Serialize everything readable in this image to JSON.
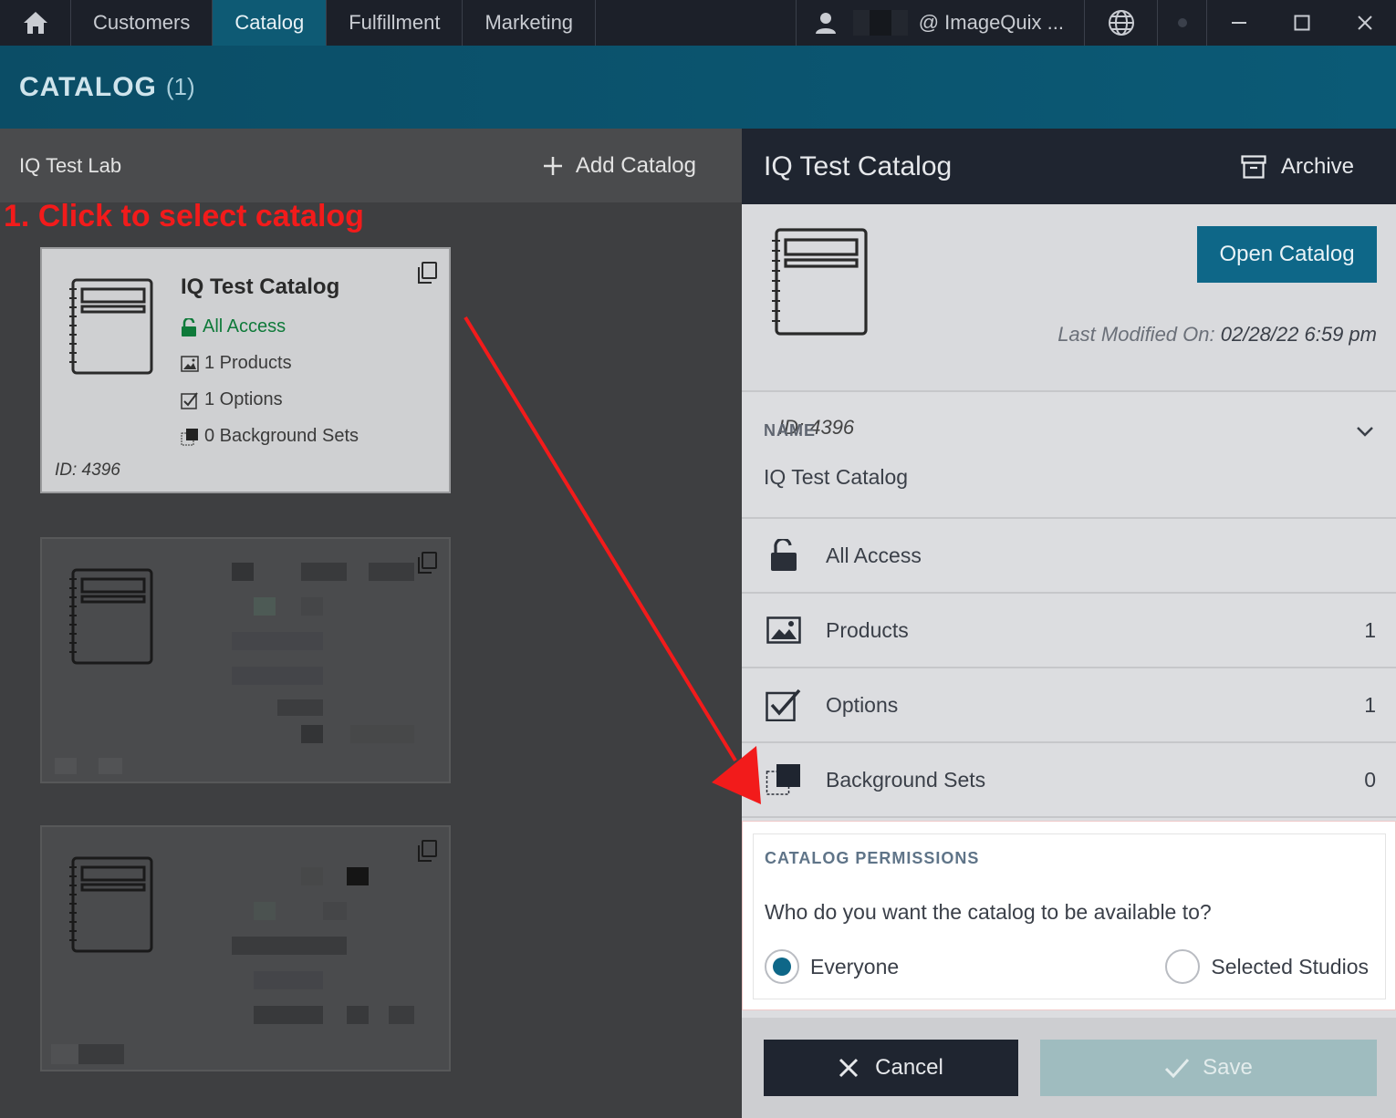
{
  "nav": {
    "tabs": [
      {
        "label": "Customers"
      },
      {
        "label": "Catalog"
      },
      {
        "label": "Fulfillment"
      },
      {
        "label": "Marketing"
      }
    ],
    "user": "@ ImageQuix ..."
  },
  "header": {
    "title": "CATALOG",
    "count": "(1)"
  },
  "left": {
    "lab": "IQ Test Lab",
    "add_label": "Add Catalog",
    "annotation": "1. Click to select catalog"
  },
  "card": {
    "title": "IQ Test Catalog",
    "access": "All Access",
    "products": "1 Products",
    "options": "1 Options",
    "backgrounds": "0 Background Sets",
    "id": "ID: 4396"
  },
  "detail": {
    "title": "IQ Test Catalog",
    "archive_label": "Archive",
    "open_label": "Open Catalog",
    "last_modified_label": "Last Modified On:",
    "last_modified_value": "02/28/22 6:59 pm",
    "id": "ID: 4396",
    "name_label": "NAME",
    "name_value": "IQ Test Catalog",
    "access": "All Access",
    "rows": [
      {
        "label": "Products",
        "count": "1"
      },
      {
        "label": "Options",
        "count": "1"
      },
      {
        "label": "Background Sets",
        "count": "0"
      }
    ]
  },
  "permissions": {
    "heading": "CATALOG PERMISSIONS",
    "question": "Who do you want the catalog to be available to?",
    "option_everyone": "Everyone",
    "option_selected": "Selected Studios"
  },
  "footer": {
    "cancel_label": "Cancel",
    "save_label": "Save"
  },
  "colors": {
    "accent": "#0e6788",
    "annotation": "#f21b1b",
    "topbar": "#1c2029"
  }
}
